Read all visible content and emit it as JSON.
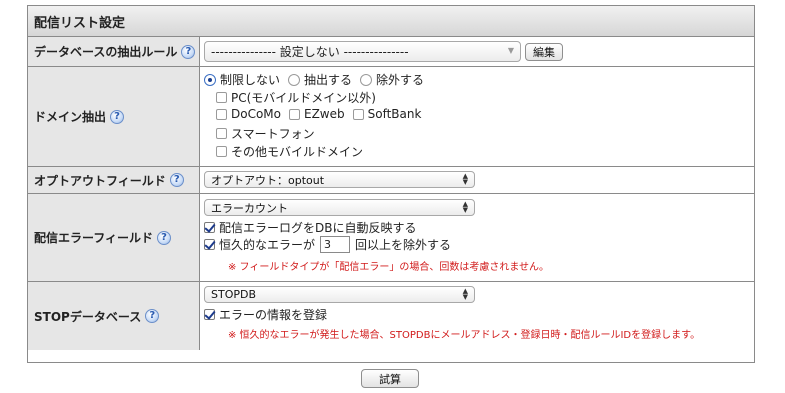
{
  "panel": {
    "title": "配信リスト設定"
  },
  "help_glyph": "?",
  "rows": {
    "rule": {
      "label": "データベースの抽出ルール",
      "select_value": "--------------- 設定しない ---------------",
      "edit_label": "編集"
    },
    "domain": {
      "label": "ドメイン抽出",
      "radios": [
        "制限しない",
        "抽出する",
        "除外する"
      ],
      "selected_radio": "制限しない",
      "checkboxes": {
        "pc": "PC(モバイルドメイン以外)",
        "docomo": "DoCoMo",
        "ezweb": "EZweb",
        "softbank": "SoftBank",
        "smartphone": "スマートフォン",
        "other_mobile": "その他モバイルドメイン"
      }
    },
    "optout": {
      "label": "オプトアウトフィールド",
      "select_value": "オプトアウト：optout"
    },
    "error_field": {
      "label": "配信エラーフィールド",
      "select_value": "エラーカウント",
      "auto_reflect_label": "配信エラーログをDBに自動反映する",
      "permanent_prefix": "恒久的なエラーが",
      "permanent_count": "3",
      "permanent_suffix": "回以上を除外する",
      "note": "※ フィールドタイプが「配信エラー」の場合、回数は考慮されません。"
    },
    "stop_db": {
      "label": "STOPデータベース",
      "select_value": "STOPDB",
      "register_label": "エラーの情報を登録",
      "note": "※ 恒久的なエラーが発生した場合、STOPDBにメールアドレス・登録日時・配信ルールIDを登録します。"
    }
  },
  "footer": {
    "submit_label": "試算"
  }
}
